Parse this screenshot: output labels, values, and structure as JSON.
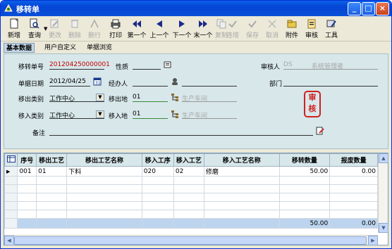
{
  "window": {
    "title": "移转单"
  },
  "toolbar": {
    "items": [
      {
        "label": "新增",
        "icon": "new-document-icon",
        "enabled": true
      },
      {
        "label": "查询",
        "icon": "query-icon",
        "enabled": true
      },
      {
        "label": "更改",
        "icon": "edit-icon",
        "enabled": false
      },
      {
        "label": "删除",
        "icon": "delete-icon",
        "enabled": false
      },
      {
        "label": "删行",
        "icon": "delete-row-icon",
        "enabled": false
      },
      {
        "label": "打印",
        "icon": "print-icon",
        "enabled": true
      },
      {
        "label": "第一个",
        "icon": "first-icon",
        "enabled": true
      },
      {
        "label": "上一个",
        "icon": "prev-icon",
        "enabled": true
      },
      {
        "label": "下一个",
        "icon": "next-icon",
        "enabled": true
      },
      {
        "label": "末一个",
        "icon": "last-icon",
        "enabled": true
      },
      {
        "label": "复制",
        "icon": "copy-icon",
        "enabled": false
      },
      {
        "label": "连增",
        "icon": "continuous-add-icon",
        "enabled": false
      },
      {
        "label": "保存",
        "icon": "save-icon",
        "enabled": false
      },
      {
        "label": "取消",
        "icon": "cancel-icon",
        "enabled": false
      },
      {
        "label": "附件",
        "icon": "attachment-icon",
        "enabled": true
      },
      {
        "label": "审核",
        "icon": "audit-icon",
        "enabled": true
      },
      {
        "label": "工具",
        "icon": "tools-icon",
        "enabled": true
      }
    ]
  },
  "tabs": [
    "基本数据",
    "用户自定义",
    "单据浏览"
  ],
  "form": {
    "doc_no_label": "移转单号",
    "doc_no": "201204250000001",
    "nature_label": "性质",
    "nature": "",
    "auditor_label": "审核人",
    "auditor_code": "DS",
    "auditor_name": "系统管理者",
    "date_label": "单据日期",
    "date": "2012/04/25",
    "handler_label": "经办人",
    "handler": "",
    "dept_label": "部门",
    "dept": "",
    "out_type_label": "移出类别",
    "out_type": "工作中心",
    "out_place_label": "移出地",
    "out_place_code": "01",
    "out_place_name": "生产车间",
    "in_type_label": "移入类别",
    "in_type": "工作中心",
    "in_place_label": "移入地",
    "in_place_code": "01",
    "in_place_name": "生产车间",
    "remark_label": "备注",
    "remark": "",
    "stamp_text": "审核"
  },
  "grid": {
    "columns": [
      "序号",
      "移出工艺",
      "移出工艺名称",
      "移入工序",
      "移入工艺",
      "移入工艺名称",
      "移转数量",
      "报废数量"
    ],
    "rows": [
      [
        "001",
        "01",
        "下料",
        "020",
        "02",
        "修磨",
        "50.00",
        "0.00"
      ]
    ],
    "total": [
      "",
      "",
      "",
      "",
      "",
      "",
      "50.00",
      "0.00"
    ]
  }
}
